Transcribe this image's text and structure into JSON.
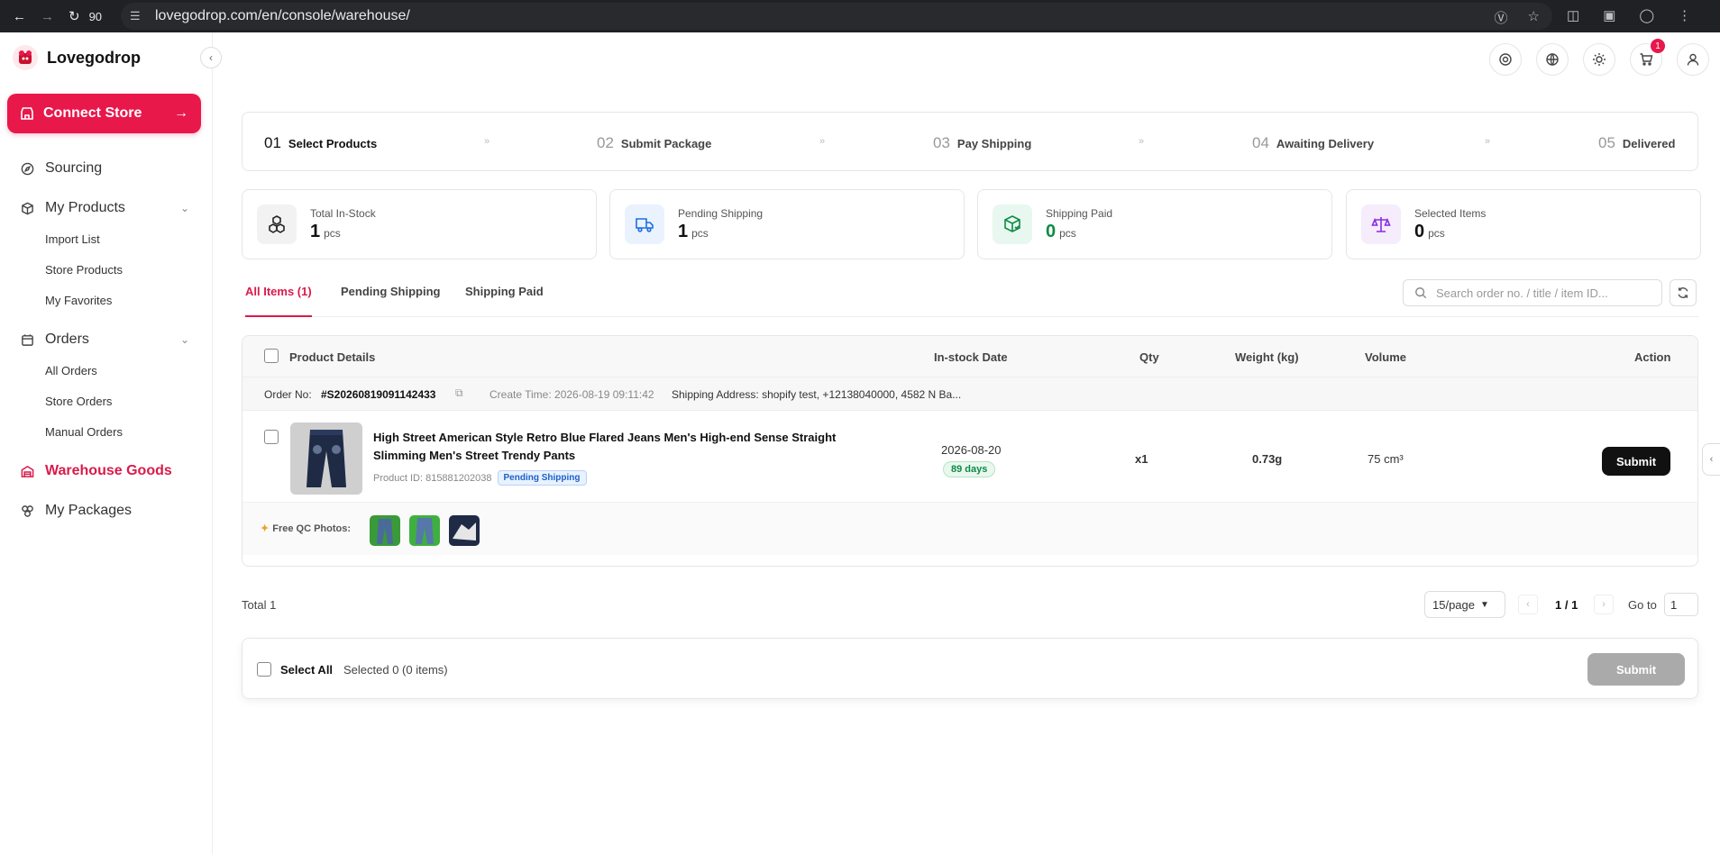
{
  "browser": {
    "zoom": "90",
    "url": "lovegodrop.com/en/console/warehouse/"
  },
  "brand": {
    "name": "Lovegodrop",
    "accent": "#e8184b"
  },
  "sidebar": {
    "connect_label": "Connect Store",
    "items": [
      {
        "label": "Sourcing"
      },
      {
        "label": "My Products",
        "children": [
          "Import List",
          "Store Products",
          "My Favorites"
        ]
      },
      {
        "label": "Orders",
        "children": [
          "All Orders",
          "Store Orders",
          "Manual Orders"
        ]
      },
      {
        "label": "Warehouse Goods",
        "active": true
      },
      {
        "label": "My Packages"
      }
    ]
  },
  "topbar": {
    "cart_count": "1"
  },
  "steps": [
    {
      "num": "01",
      "name": "Select Products"
    },
    {
      "num": "02",
      "name": "Submit Package"
    },
    {
      "num": "03",
      "name": "Pay Shipping"
    },
    {
      "num": "04",
      "name": "Awaiting Delivery"
    },
    {
      "num": "05",
      "name": "Delivered"
    }
  ],
  "stats": [
    {
      "label": "Total In-Stock",
      "value": "1",
      "unit": "pcs",
      "color": "#111111"
    },
    {
      "label": "Pending Shipping",
      "value": "1",
      "unit": "pcs",
      "color": "#111111"
    },
    {
      "label": "Shipping Paid",
      "value": "0",
      "unit": "pcs",
      "color": "#0e8a45"
    },
    {
      "label": "Selected Items",
      "value": "0",
      "unit": "pcs",
      "color": "#111111"
    }
  ],
  "tabs": [
    "All Items (1)",
    "Pending Shipping",
    "Shipping Paid"
  ],
  "search": {
    "placeholder": "Search order no. / title / item ID..."
  },
  "table": {
    "headers": {
      "product": "Product Details",
      "date": "In-stock Date",
      "qty": "Qty",
      "weight": "Weight (kg)",
      "volume": "Volume",
      "action": "Action"
    },
    "order": {
      "label": "Order No:",
      "number": "#S20260819091142433",
      "create_time": "Create Time: 2026-08-19 09:11:42",
      "address": "Shipping Address: shopify test, +12138040000, 4582 N Ba..."
    },
    "product": {
      "title": "High Street American Style Retro Blue Flared Jeans Men's High-end Sense Straight Slimming Men's Street Trendy Pants",
      "id": "Product ID: 815881202038",
      "status": "Pending Shipping",
      "date": "2026-08-20",
      "days": "89 days",
      "qty": "x1",
      "weight": "0.73g",
      "volume": "75 cm³",
      "action": "Submit"
    },
    "qc_label": "Free QC Photos:"
  },
  "pagination": {
    "total": "Total 1",
    "page_size": "15/page",
    "page": "1 / 1",
    "goto_label": "Go to",
    "goto_value": "1"
  },
  "footer": {
    "select_all": "Select All",
    "selected": "Selected 0 (0 items)",
    "submit": "Submit"
  }
}
